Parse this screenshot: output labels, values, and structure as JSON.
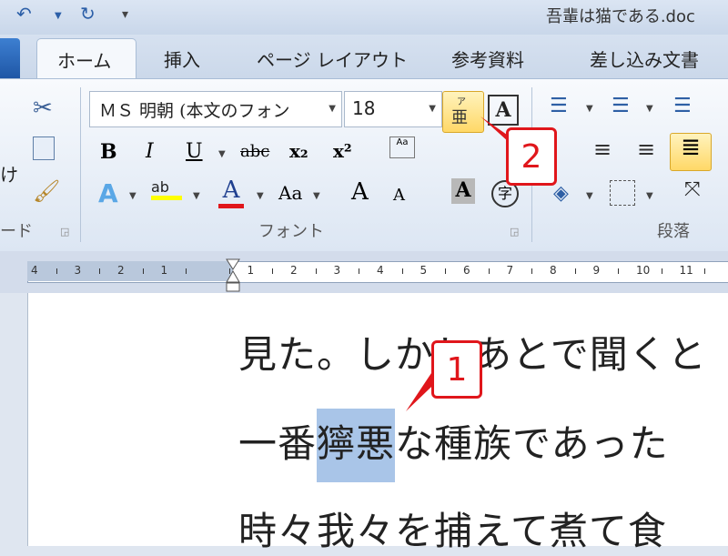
{
  "window": {
    "title": "吾輩は猫である.doc"
  },
  "tabs": {
    "home": "ホーム",
    "insert": "挿入",
    "layout": "ページ レイアウト",
    "references": "参考資料",
    "mailings": "差し込み文書"
  },
  "clipboard": {
    "paste_label": "け",
    "group_label": "ード"
  },
  "font_group": {
    "font_name": "ＭＳ 明朝 (本文のフォン",
    "font_size": "18",
    "group_label": "フォント",
    "phonetic_ruby": "ア",
    "phonetic_kanji": "亜",
    "border_glyph": "A",
    "bold": "B",
    "italic": "I",
    "underline": "U",
    "strike": "abc",
    "subscript": "x₂",
    "superscript": "x²",
    "text_effect": "A",
    "highlight": "ab",
    "font_color": "A",
    "change_case": "Aa",
    "grow": "A",
    "shrink": "A",
    "shading": "A",
    "enclose": "字"
  },
  "paragraph_group": {
    "group_label": "段落"
  },
  "ruler": {
    "labels": [
      "4",
      "3",
      "2",
      "1",
      "",
      "1",
      "2",
      "3",
      "4",
      "5",
      "6",
      "7",
      "8",
      "9",
      "10",
      "11"
    ]
  },
  "document": {
    "lines": [
      "見た。しかしあとで聞くと",
      "一番",
      "獰悪",
      "な種族であった",
      "時々我々を捕えて煮て食"
    ]
  },
  "callouts": {
    "one": "1",
    "two": "2"
  },
  "colors": {
    "accent_red": "#e0161b",
    "highlight_yellow": "#ffd867",
    "selection": "#a9c5e8"
  }
}
